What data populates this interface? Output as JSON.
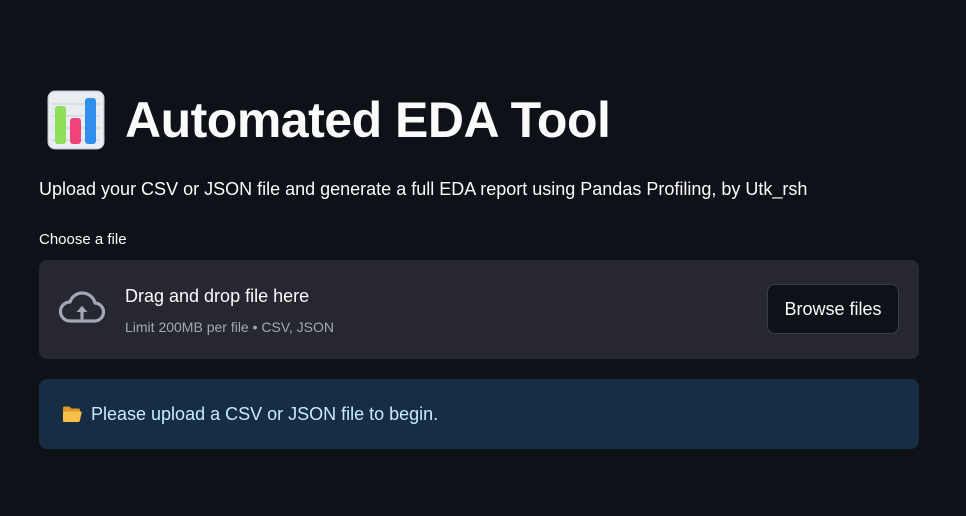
{
  "header": {
    "title": "Automated EDA Tool",
    "title_icon": "bar-chart-emoji-icon",
    "subtitle": "Upload your CSV or JSON file and generate a full EDA report using Pandas Profiling, by Utk_rsh"
  },
  "uploader": {
    "label": "Choose a file",
    "instruction": "Drag and drop file here",
    "limits": "Limit 200MB per file • CSV, JSON",
    "browse_label": "Browse files",
    "icon": "cloud-upload-icon"
  },
  "info": {
    "icon": "open-folder-icon",
    "message": "Please upload a CSV or JSON file to begin."
  },
  "colors": {
    "background": "#0e1117",
    "dropzone": "#262730",
    "info_bg": "#172d43",
    "info_text": "#c7ebff"
  }
}
